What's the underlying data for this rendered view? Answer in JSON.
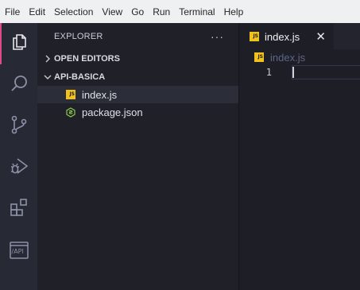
{
  "menu": [
    "File",
    "Edit",
    "Selection",
    "View",
    "Go",
    "Run",
    "Terminal",
    "Help"
  ],
  "activity_bar": [
    {
      "name": "explorer",
      "icon": "files-icon",
      "active": true
    },
    {
      "name": "search",
      "icon": "search-icon",
      "active": false
    },
    {
      "name": "source-control",
      "icon": "source-control-icon",
      "active": false
    },
    {
      "name": "run-debug",
      "icon": "debug-icon",
      "active": false
    },
    {
      "name": "extensions",
      "icon": "extensions-icon",
      "active": false
    },
    {
      "name": "api",
      "icon": "api-icon",
      "active": false,
      "label": "/API"
    }
  ],
  "sidebar": {
    "title": "EXPLORER",
    "more": "···",
    "open_editors": "OPEN EDITORS",
    "folder": "API-BASICA",
    "files": [
      {
        "name": "index.js",
        "icon": "js-file-icon",
        "selected": true
      },
      {
        "name": "package.json",
        "icon": "nodejs-file-icon",
        "selected": false
      }
    ]
  },
  "editor": {
    "tab_label": "index.js",
    "tab_close": "✕",
    "breadcrumb": "index.js",
    "js_badge": "JS",
    "line_number": "1"
  },
  "colors": {
    "accent": "#e0498b",
    "js_badge": "#f1c21b",
    "node_green": "#8cc84b",
    "background": "#1e1f26",
    "sidebar": "#1f2028",
    "activity": "#272935"
  }
}
